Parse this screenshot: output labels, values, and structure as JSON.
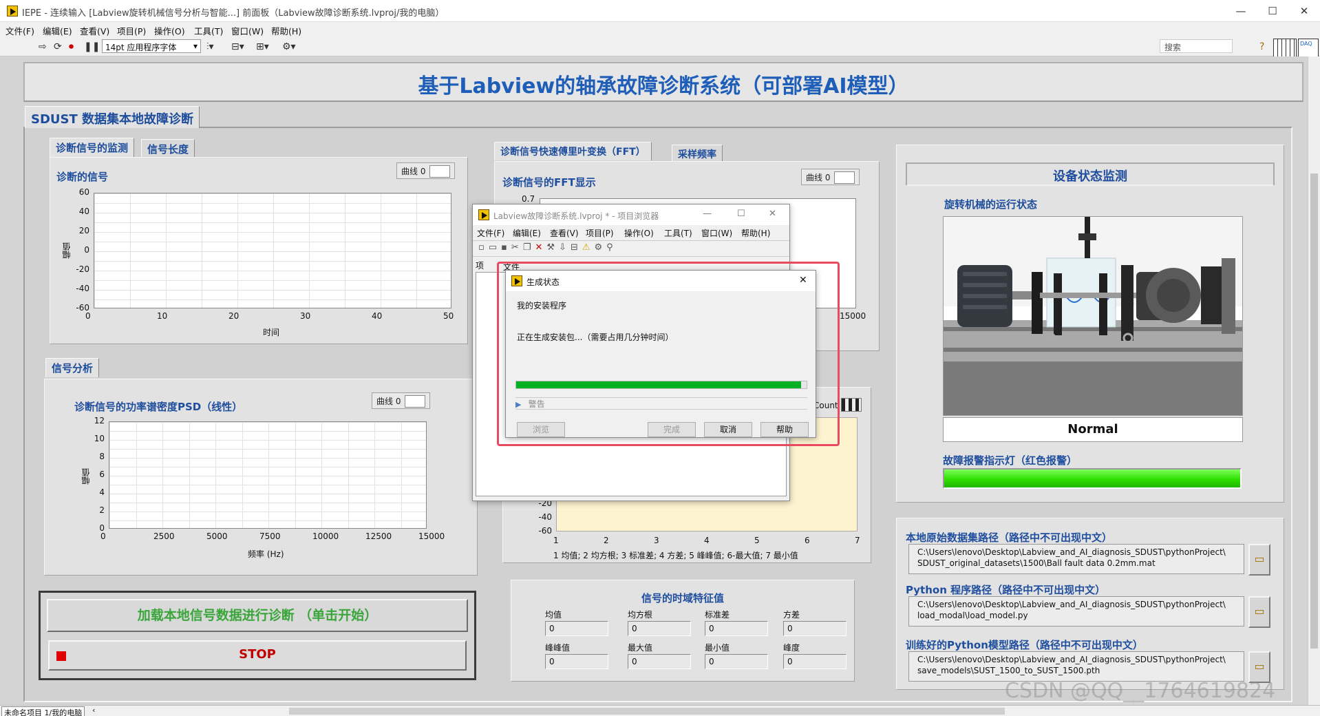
{
  "window": {
    "title": "IEPE - 连续输入 [Labview旋转机械信号分析与智能...] 前面板（Labview故障诊断系统.lvproj/我的电脑）",
    "controls": [
      "—",
      "☐",
      "✕"
    ]
  },
  "menu": [
    "文件(F)",
    "编辑(E)",
    "查看(V)",
    "项目(P)",
    "操作(O)",
    "工具(T)",
    "窗口(W)",
    "帮助(H)"
  ],
  "toolbar": {
    "font_select": "14pt 应用程序字体",
    "search_placeholder": "搜索"
  },
  "banner": {
    "title": "基于Labview的轴承故障诊断系统（可部署AI模型）"
  },
  "main_tab": "SDUST 数据集本地故障诊断",
  "signal_monitor": {
    "tabs": [
      "诊断信号的监测",
      "信号长度"
    ],
    "graph_title": "诊断的信号",
    "legend": "曲线 0",
    "ylabel": "幅值",
    "xlabel": "时间",
    "yticks": [
      "60",
      "40",
      "20",
      "0",
      "-20",
      "-40",
      "-60"
    ],
    "xticks": [
      "0",
      "10",
      "20",
      "30",
      "40",
      "50"
    ]
  },
  "signal_analysis": {
    "tab": "信号分析",
    "graph_title": "诊断信号的功率谱密度PSD（线性）",
    "legend": "曲线 0",
    "ylabel": "幅值",
    "xlabel": "频率 (Hz)",
    "yticks": [
      "12",
      "10",
      "8",
      "6",
      "4",
      "2",
      "0"
    ],
    "xticks": [
      "0",
      "2500",
      "5000",
      "7500",
      "10000",
      "12500",
      "15000"
    ]
  },
  "fft": {
    "tabs": [
      "诊断信号快速傅里叶变换（FFT）",
      "采样频率"
    ],
    "graph_title": "诊断信号的FFT显示",
    "legend": "曲线 0",
    "ytick_top": "0.7",
    "xtick_right": "15000"
  },
  "feature_chart": {
    "count_label": "Count",
    "yticks": [
      "-20",
      "-40",
      "-60"
    ],
    "xticks": [
      "1",
      "2",
      "3",
      "4",
      "5",
      "6",
      "7"
    ],
    "xlabel": "1 均值;  2 均方根;  3 标准差;  4 方差;  5 峰峰值;  6-最大值;  7 最小值"
  },
  "controls_box": {
    "load_button": "加载本地信号数据进行诊断 （单击开始）",
    "stop_button": "STOP"
  },
  "time_features": {
    "title": "信号的时域特征值",
    "fields": [
      {
        "label": "均值",
        "value": "0"
      },
      {
        "label": "均方根",
        "value": "0"
      },
      {
        "label": "标准差",
        "value": "0"
      },
      {
        "label": "方差",
        "value": "0"
      },
      {
        "label": "峰峰值",
        "value": "0"
      },
      {
        "label": "最大值",
        "value": "0"
      },
      {
        "label": "最小值",
        "value": "0"
      },
      {
        "label": "峰度",
        "value": "0"
      }
    ]
  },
  "device_status": {
    "title": "设备状态监测",
    "subtitle": "旋转机械的运行状态",
    "state": "Normal",
    "alarm_label": "故障报警指示灯（红色报警）",
    "alarm_color": "#2fe000"
  },
  "paths": [
    {
      "label": "本地原始数据集路径（路径中不可出现中文）",
      "line1": "C:\\Users\\lenovo\\Desktop\\Labview_and_AI_diagnosis_SDUST\\pythonProject\\",
      "line2": "SDUST_original_datasets\\1500\\Ball fault data 0.2mm.mat"
    },
    {
      "label": "Python 程序路径（路径中不可出现中文）",
      "line1": "C:\\Users\\lenovo\\Desktop\\Labview_and_AI_diagnosis_SDUST\\pythonProject\\",
      "line2": "load_modal\\load_model.py"
    },
    {
      "label": "训练好的Python模型路径（路径中不可出现中文）",
      "line1": "C:\\Users\\lenovo\\Desktop\\Labview_and_AI_diagnosis_SDUST\\pythonProject\\",
      "line2": "save_models\\SUST_1500_to_SUST_1500.pth"
    }
  ],
  "project_window": {
    "title": "Labview故障诊断系统.lvproj * - 项目浏览器",
    "menu": [
      "文件(F)",
      "编辑(E)",
      "查看(V)",
      "项目(P)",
      "操作(O)",
      "工具(T)",
      "窗口(W)",
      "帮助(H)"
    ],
    "tabs": [
      "项",
      "文件"
    ]
  },
  "build_dialog": {
    "title": "生成状态",
    "item": "我的安装程序",
    "message": "正在生成安装包...（需要占用几分钟时间）",
    "progress": 0.98,
    "warning_label": "警告",
    "buttons": [
      "浏览",
      "完成",
      "取消",
      "帮助"
    ]
  },
  "statusbar": {
    "text": "未命名项目 1/我的电脑"
  },
  "watermark": "CSDN @QQ__1764619824"
}
